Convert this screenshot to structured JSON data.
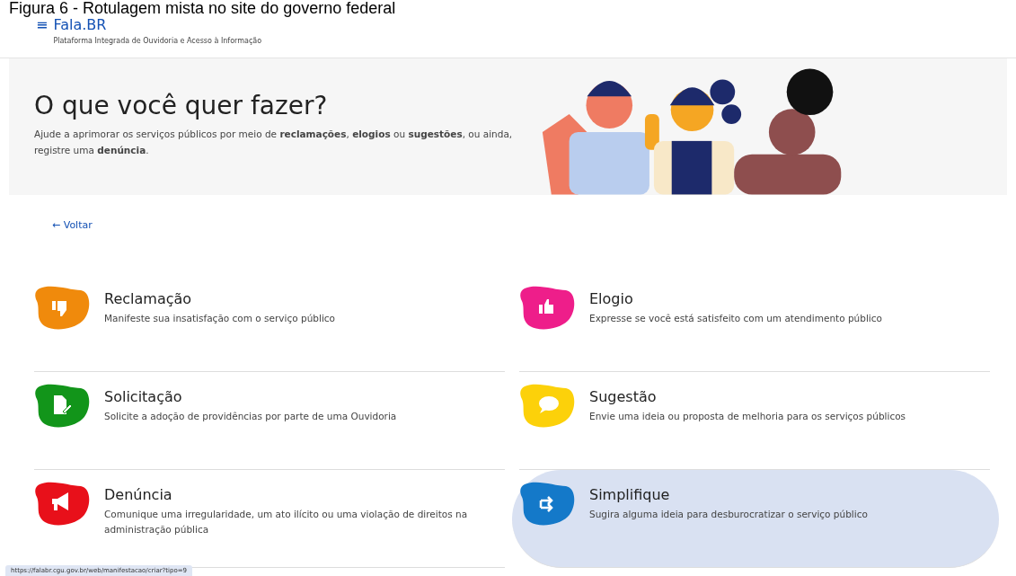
{
  "caption": "Figura 6 - Rotulagem mista no site do governo federal",
  "header": {
    "menu_glyph": "≡",
    "logo": "Fala.BR",
    "subtitle": "Plataforma Integrada de Ouvidoria e Acesso à Informação"
  },
  "hero": {
    "title": "O que você quer fazer?",
    "text": "Ajude a aprimorar os serviços públicos por meio de **reclamações**, **elogios** ou **sugestões**, ou ainda, registre uma **denúncia**."
  },
  "back_link": {
    "arrow": "←",
    "label": "Voltar"
  },
  "options": [
    {
      "title": "Reclamação",
      "description": "Manifeste sua insatisfação com o serviço público",
      "kind": "thumbs-down",
      "color": "#f08a0c",
      "selected": false
    },
    {
      "title": "Elogio",
      "description": "Expresse se você está satisfeito com um atendimento público",
      "kind": "thumbs-up",
      "color": "#ee1e8a",
      "selected": false
    },
    {
      "title": "Solicitação",
      "description": "Solicite a adoção de providências por parte de uma Ouvidoria",
      "kind": "document",
      "color": "#12951a",
      "selected": false
    },
    {
      "title": "Sugestão",
      "description": "Envie uma ideia ou proposta de melhoria para os serviços públicos",
      "kind": "speech",
      "color": "#fcd10a",
      "selected": false
    },
    {
      "title": "Denúncia",
      "description": "Comunique uma irregularidade, um ato ilícito ou uma violação de direitos na administração pública",
      "kind": "megaphone",
      "color": "#e8101a",
      "selected": false
    },
    {
      "title": "Simplifique",
      "description": "Sugira alguma ideia para desburocratizar o serviço público",
      "kind": "arrows",
      "color": "#1479c9",
      "selected": true
    }
  ],
  "status_url": "https://falabr.cgu.gov.br/web/manifestacao/criar?tipo=9"
}
